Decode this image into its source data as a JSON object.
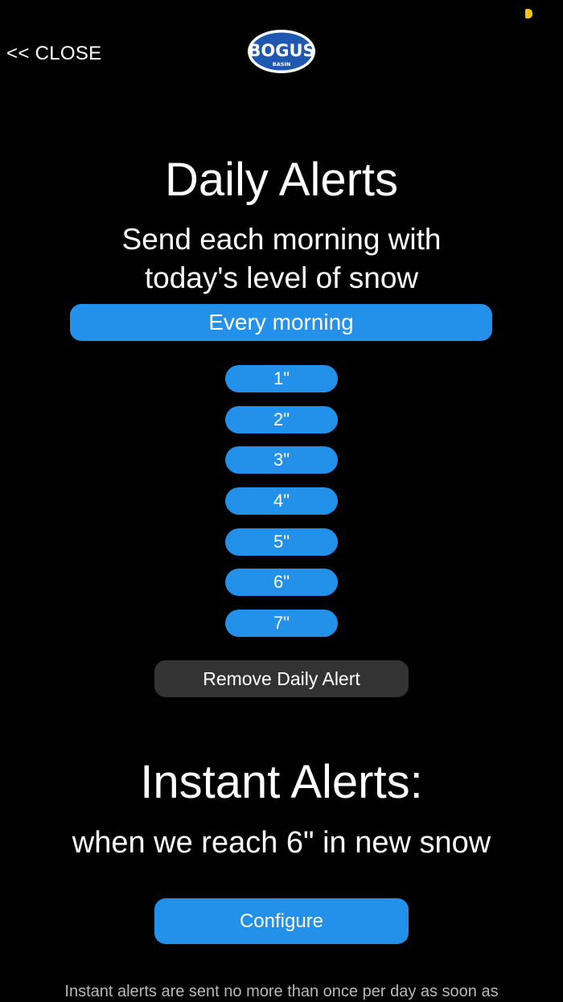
{
  "header": {
    "close_label": "<< CLOSE",
    "logo": {
      "word": "BOGUS",
      "sub": "BASIN",
      "fill": "#1f58b0",
      "icon": "bogus-basin-logo"
    },
    "status_indicator_color": "#f6c21a"
  },
  "daily": {
    "title": "Daily Alerts",
    "subtitle_line1": "Send each morning with",
    "subtitle_line2": "today's level of snow",
    "every_morning_label": "Every morning",
    "levels": [
      "1\"",
      "2\"",
      "3\"",
      "4\"",
      "5\"",
      "6\"",
      "7\""
    ],
    "remove_label": "Remove Daily Alert"
  },
  "instant": {
    "title": "Instant Alerts:",
    "subtitle": "when we reach 6\" in new snow",
    "configure_label": "Configure",
    "footnote": "Instant alerts are sent no more than once per day as soon as"
  },
  "colors": {
    "accent": "#2390ea",
    "secondary_button": "#333333",
    "background": "#000000"
  }
}
